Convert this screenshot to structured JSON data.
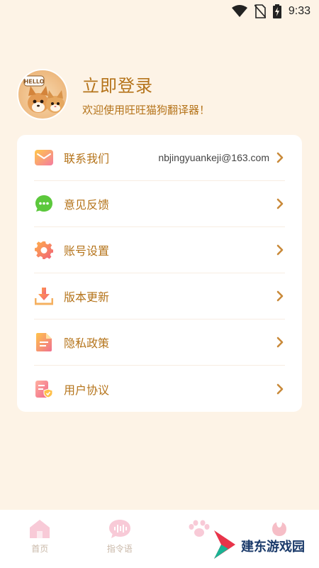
{
  "status_bar": {
    "time": "9:33"
  },
  "profile": {
    "avatar_badge": "HELLO",
    "title": "立即登录",
    "subtitle": "欢迎使用旺旺猫狗翻译器！"
  },
  "menu": [
    {
      "label": "联系我们",
      "value": "nbjingyuankeji@163.com",
      "icon": "mail-icon"
    },
    {
      "label": "意见反馈",
      "value": "",
      "icon": "chat-bubble-icon"
    },
    {
      "label": "账号设置",
      "value": "",
      "icon": "gear-icon"
    },
    {
      "label": "版本更新",
      "value": "",
      "icon": "download-icon"
    },
    {
      "label": "隐私政策",
      "value": "",
      "icon": "document-icon"
    },
    {
      "label": "用户协议",
      "value": "",
      "icon": "agreement-icon"
    }
  ],
  "bottom_nav": [
    {
      "label": "首页",
      "icon": "home-icon"
    },
    {
      "label": "指令语",
      "icon": "voice-wave-icon"
    },
    {
      "label": "",
      "icon": "paw-icon"
    },
    {
      "label": "",
      "icon": "petal-icon"
    }
  ],
  "watermark": {
    "text": "建东游戏园"
  },
  "colors": {
    "background": "#fdf3e6",
    "accent": "#b5741b",
    "card": "#ffffff",
    "chevron": "#c98a3a"
  }
}
